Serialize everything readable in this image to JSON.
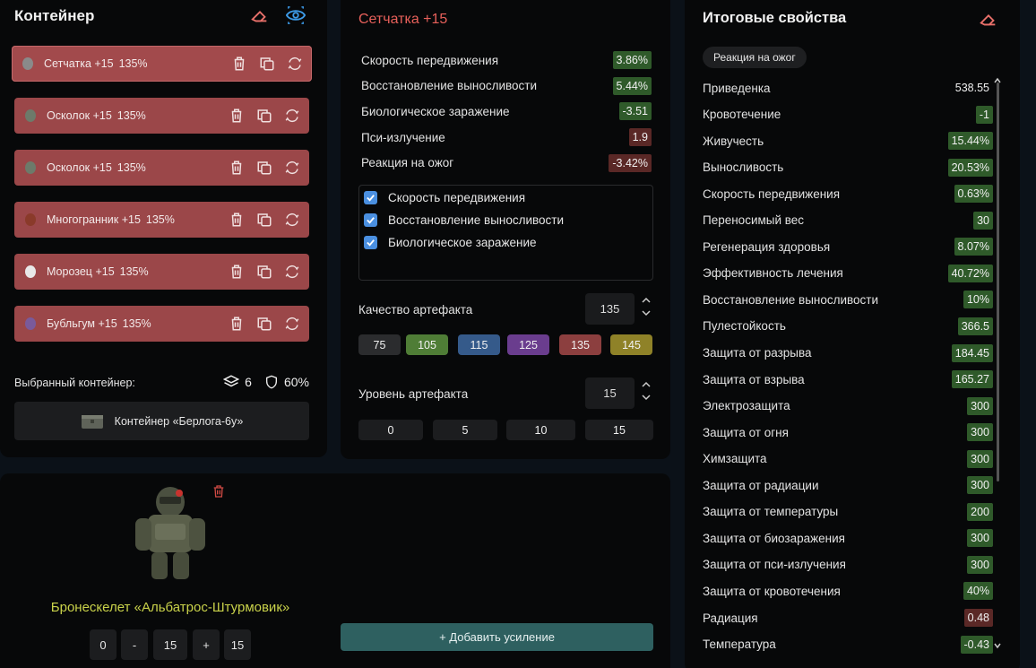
{
  "container": {
    "title": "Контейнер",
    "slots": [
      {
        "name": "Сетчатка +15",
        "quality": "135%",
        "color": "#8a8a8a"
      },
      {
        "name": "Осколок +15",
        "quality": "135%",
        "color": "#6d7a6a"
      },
      {
        "name": "Осколок +15",
        "quality": "135%",
        "color": "#6d7a6a"
      },
      {
        "name": "Многогранник +15",
        "quality": "135%",
        "color": "#8a3a2a"
      },
      {
        "name": "Морозец +15",
        "quality": "135%",
        "color": "#e8e8e8"
      },
      {
        "name": "Бубльгум +15",
        "quality": "135%",
        "color": "#7a5a9a"
      }
    ],
    "selected_label": "Выбранный контейнер:",
    "capacity": "6",
    "protection": "60%",
    "container_name": "Контейнер «Берлога-6у»"
  },
  "artifact": {
    "title": "Сетчатка +15",
    "props": [
      {
        "label": "Скорость передвижения",
        "value": "3.86%",
        "tone": "green"
      },
      {
        "label": "Восстановление выносливости",
        "value": "5.44%",
        "tone": "green"
      },
      {
        "label": "Биологическое заражение",
        "value": "-3.51",
        "tone": "green"
      },
      {
        "label": "Пси-излучение",
        "value": "1.9",
        "tone": "red"
      },
      {
        "label": "Реакция на ожог",
        "value": "-3.42%",
        "tone": "red"
      }
    ],
    "checks": [
      "Скорость передвижения",
      "Восстановление выносливости",
      "Биологическое заражение"
    ],
    "quality_label": "Качество артефакта",
    "quality_value": "135",
    "quality_chips": [
      {
        "label": "75",
        "color": "#2b2c2e"
      },
      {
        "label": "105",
        "color": "#4f7d36"
      },
      {
        "label": "115",
        "color": "#355a8a"
      },
      {
        "label": "125",
        "color": "#6a3d8e"
      },
      {
        "label": "135",
        "color": "#8c3f3f"
      },
      {
        "label": "145",
        "color": "#8f8228"
      }
    ],
    "level_label": "Уровень артефакта",
    "level_value": "15",
    "level_chips": [
      "0",
      "5",
      "10",
      "15"
    ]
  },
  "armor": {
    "name": "Бронескелет «Альбатрос-Штурмовик»",
    "min": "0",
    "minus": "-",
    "value": "15",
    "plus": "+",
    "max": "15",
    "add_button": "+ Добавить усиление"
  },
  "final": {
    "title": "Итоговые свойства",
    "tag": "Реакция на ожог",
    "rows": [
      {
        "label": "Приведенка",
        "value": "538.55",
        "tone": "plain"
      },
      {
        "label": "Кровотечение",
        "value": "-1",
        "tone": "green"
      },
      {
        "label": "Живучесть",
        "value": "15.44%",
        "tone": "green"
      },
      {
        "label": "Выносливость",
        "value": "20.53%",
        "tone": "green"
      },
      {
        "label": "Скорость передвижения",
        "value": "0.63%",
        "tone": "green"
      },
      {
        "label": "Переносимый вес",
        "value": "30",
        "tone": "green"
      },
      {
        "label": "Регенерация здоровья",
        "value": "8.07%",
        "tone": "green"
      },
      {
        "label": "Эффективность лечения",
        "value": "40.72%",
        "tone": "green"
      },
      {
        "label": "Восстановление выносливости",
        "value": "10%",
        "tone": "green"
      },
      {
        "label": "Пулестойкость",
        "value": "366.5",
        "tone": "green"
      },
      {
        "label": "Защита от разрыва",
        "value": "184.45",
        "tone": "green"
      },
      {
        "label": "Защита от взрыва",
        "value": "165.27",
        "tone": "green"
      },
      {
        "label": "Электрозащита",
        "value": "300",
        "tone": "green"
      },
      {
        "label": "Защита от огня",
        "value": "300",
        "tone": "green"
      },
      {
        "label": "Химзащита",
        "value": "300",
        "tone": "green"
      },
      {
        "label": "Защита от радиации",
        "value": "300",
        "tone": "green"
      },
      {
        "label": "Защита от температуры",
        "value": "200",
        "tone": "green"
      },
      {
        "label": "Защита от биозаражения",
        "value": "300",
        "tone": "green"
      },
      {
        "label": "Защита от пси-излучения",
        "value": "300",
        "tone": "green"
      },
      {
        "label": "Защита от кровотечения",
        "value": "40%",
        "tone": "green"
      },
      {
        "label": "Радиация",
        "value": "0.48",
        "tone": "red"
      },
      {
        "label": "Температура",
        "value": "-0.43",
        "tone": "green"
      }
    ]
  }
}
